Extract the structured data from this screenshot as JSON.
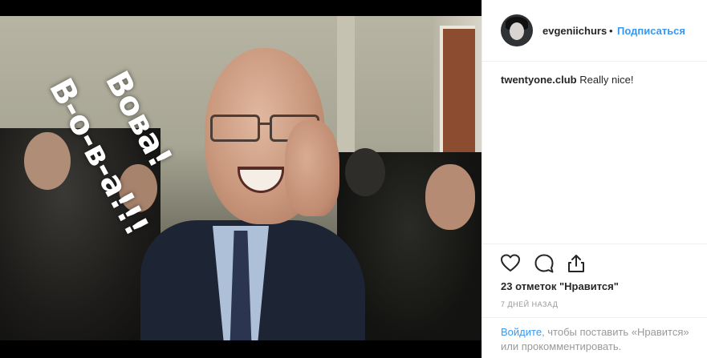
{
  "post": {
    "image_caption_line1": "Вова!",
    "image_caption_line2": "В-о-в-а!!!",
    "author": {
      "username": "evgeniichurs",
      "separator": "•",
      "follow_label": "Подписаться"
    },
    "comment": {
      "username": "twentyone.club",
      "text": "Really nice!"
    },
    "likes_text": "23 отметок \"Нравится\"",
    "timestamp": "7 ДНЕЙ НАЗАД",
    "login_prompt": {
      "link_text": "Войдите",
      "rest_text": ", чтобы поставить «Нравится» или прокомментировать."
    }
  },
  "icons": {
    "like": "heart-icon",
    "comment": "comment-bubble-icon",
    "share": "share-icon"
  },
  "colors": {
    "link_blue": "#3897f0",
    "text_dark": "#262626",
    "text_muted": "#999999",
    "divider": "#efefef"
  }
}
